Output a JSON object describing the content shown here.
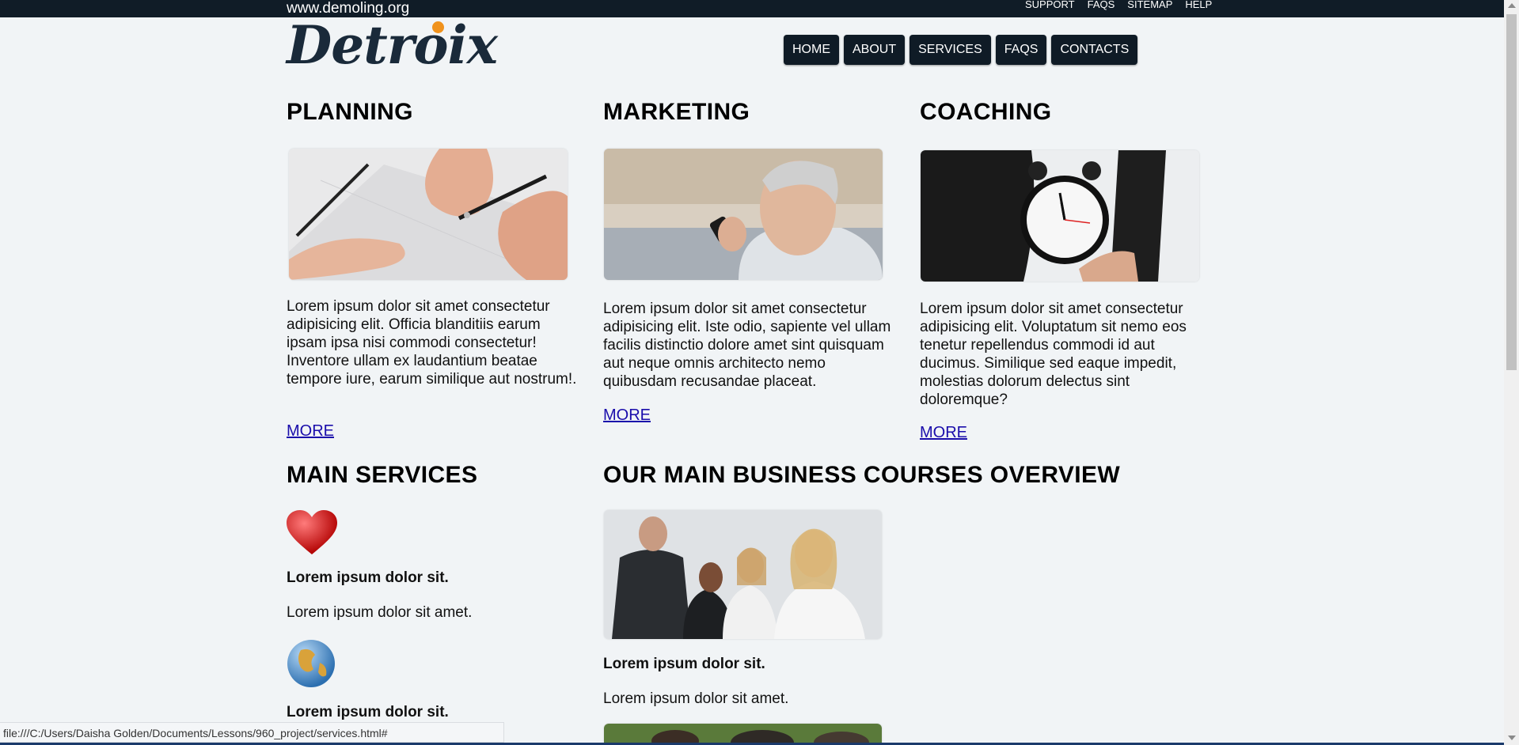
{
  "header": {
    "site_url": "www.demoling.org",
    "top_links": [
      "SUPPORT",
      "FAQS",
      "SITEMAP",
      "HELP"
    ],
    "logo_text": "Detroix",
    "nav": [
      "HOME",
      "ABOUT",
      "SERVICES",
      "FAQS",
      "CONTACTS"
    ]
  },
  "sections": [
    {
      "title": "PLANNING",
      "image": "hands-drafting-photo",
      "text": "Lorem ipsum dolor sit amet consectetur adipisicing elit. Officia blanditiis earum ipsam ipsa nisi commodi consectetur! Inventore ullam ex laudantium beatae tempore iure, earum similique aut nostrum!.",
      "more": "MORE"
    },
    {
      "title": "MARKETING",
      "image": "businessman-on-phone-photo",
      "text": "Lorem ipsum dolor sit amet consectetur adipisicing elit. Iste odio, sapiente vel ullam facilis distinctio dolore amet sint quisquam aut neque omnis architecto nemo quibusdam recusandae placeat.",
      "more": "MORE"
    },
    {
      "title": "COACHING",
      "image": "alarm-clock-photo",
      "text": "Lorem ipsum dolor sit amet consectetur adipisicing elit. Voluptatum sit nemo eos tenetur repellendus commodi id aut ducimus. Similique sed eaque impedit, molestias dolorum delectus sint doloremque?",
      "more": "MORE"
    }
  ],
  "main_services": {
    "title": "MAIN SERVICES",
    "items": [
      {
        "icon": "heart-icon",
        "heading": "Lorem ipsum dolor sit.",
        "text": "Lorem ipsum dolor sit amet."
      },
      {
        "icon": "globe-icon",
        "heading": "Lorem ipsum dolor sit."
      }
    ]
  },
  "courses": {
    "title": "OUR MAIN BUSINESS COURSES OVERVIEW",
    "items": [
      {
        "image": "business-team-photo",
        "heading": "Lorem ipsum dolor sit.",
        "text": "Lorem ipsum dolor sit amet."
      }
    ]
  },
  "status_bar": "file:///C:/Users/Daisha Golden/Documents/Lessons/960_project/services.html#",
  "colors": {
    "topbar": "#101c27",
    "nav_bg": "#0f1b26",
    "logo_dot": "#f0921c",
    "link": "#1a0dab",
    "page_bg": "#f1f4f6"
  }
}
